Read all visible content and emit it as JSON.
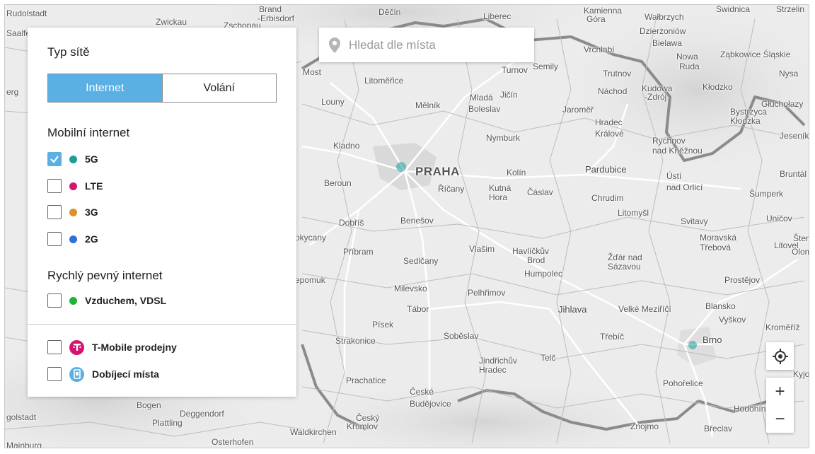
{
  "search": {
    "placeholder": "Hledat dle místa",
    "icon": "map-pin-icon"
  },
  "panel": {
    "title": "Typ sítě",
    "toggle": {
      "active": "Internet",
      "inactive": "Volání"
    },
    "mobile_section": "Mobilní internet",
    "mobile_options": [
      {
        "label": "5G",
        "color": "#1a9e96",
        "checked": true
      },
      {
        "label": "LTE",
        "color": "#d6136e",
        "checked": false
      },
      {
        "label": "3G",
        "color": "#d9912a",
        "checked": false
      },
      {
        "label": "2G",
        "color": "#2f6fdc",
        "checked": false
      }
    ],
    "fixed_section": "Rychlý pevný internet",
    "fixed_options": [
      {
        "label": "Vzduchem, VDSL",
        "color": "#1fb23a",
        "checked": false
      }
    ],
    "extra_options": [
      {
        "label": "T-Mobile prodejny",
        "color": "#d6136e",
        "icon": "t-mobile-logo-icon",
        "checked": false
      },
      {
        "label": "Dobíjecí místa",
        "color": "#5aafe3",
        "icon": "phone-card-icon",
        "checked": false
      }
    ]
  },
  "controls": {
    "locate_icon": "crosshair-icon",
    "zoom_in": "+",
    "zoom_out": "−"
  },
  "map": {
    "labels": [
      {
        "t": "Rudolstadt"
      },
      {
        "t": "Saalfeld"
      },
      {
        "t": "erg"
      },
      {
        "t": "Zwickau"
      },
      {
        "t": "Brand"
      },
      {
        "t": "-Erbisdorf"
      },
      {
        "t": "Zschopau"
      },
      {
        "t": "Děčín"
      },
      {
        "t": "Liberec"
      },
      {
        "t": "Kamienna"
      },
      {
        "t": "Góra"
      },
      {
        "t": "Wałbrzych"
      },
      {
        "t": "Świdnica"
      },
      {
        "t": "Strzelin"
      },
      {
        "t": "Dzierżoniów"
      },
      {
        "t": "Bielawa"
      },
      {
        "t": "Nowa"
      },
      {
        "t": "Ruda"
      },
      {
        "t": "Ząbkowice Śląskie"
      },
      {
        "t": "Nysa"
      },
      {
        "t": "Vrchlabí"
      },
      {
        "t": "Semily"
      },
      {
        "t": "Trutnov"
      },
      {
        "t": "Turnov"
      },
      {
        "t": "Most"
      },
      {
        "t": "Litoměřice"
      },
      {
        "t": "Mladá"
      },
      {
        "t": "Boleslav"
      },
      {
        "t": "Jičín"
      },
      {
        "t": "Náchod"
      },
      {
        "t": "Kudowa"
      },
      {
        "t": "-Zdrój"
      },
      {
        "t": "Kłodzko"
      },
      {
        "t": "Bystrzyca"
      },
      {
        "t": "Kłodzka"
      },
      {
        "t": "Głuchołazy"
      },
      {
        "t": "Louny"
      },
      {
        "t": "Mělník"
      },
      {
        "t": "Jaroměř"
      },
      {
        "t": "Hradec"
      },
      {
        "t": "Králové"
      },
      {
        "t": "Rychnov"
      },
      {
        "t": "nad Kněžnou"
      },
      {
        "t": "Jeseník"
      },
      {
        "t": "Kladno"
      },
      {
        "t": "Nymburk"
      },
      {
        "t": "PRAHA"
      },
      {
        "t": "Kolín"
      },
      {
        "t": "Pardubice"
      },
      {
        "t": "Bruntál"
      },
      {
        "t": "Ústí"
      },
      {
        "t": "nad Orlicí"
      },
      {
        "t": "Beroun"
      },
      {
        "t": "Říčany"
      },
      {
        "t": "Kutná"
      },
      {
        "t": "Hora"
      },
      {
        "t": "Čáslav"
      },
      {
        "t": "Chrudim"
      },
      {
        "t": "Šumperk"
      },
      {
        "t": "Litomyšl"
      },
      {
        "t": "Dobříš"
      },
      {
        "t": "Benešov"
      },
      {
        "t": "Svitavy"
      },
      {
        "t": "Uničov"
      },
      {
        "t": "okycany"
      },
      {
        "t": "Moravská"
      },
      {
        "t": "Třebová"
      },
      {
        "t": "Šten"
      },
      {
        "t": "Příbram"
      },
      {
        "t": "Vlašim"
      },
      {
        "t": "Havlíčkův"
      },
      {
        "t": "Brod"
      },
      {
        "t": "Litovel"
      },
      {
        "t": "Olom"
      },
      {
        "t": "Sedlčany"
      },
      {
        "t": "Žďár nad"
      },
      {
        "t": "Sázavou"
      },
      {
        "t": "Humpolec"
      },
      {
        "t": "epomuk"
      },
      {
        "t": "Prostějov"
      },
      {
        "t": "Milevsko"
      },
      {
        "t": "Pelhřimov"
      },
      {
        "t": "Jihlava"
      },
      {
        "t": "Velké Meziříčí"
      },
      {
        "t": "Blansko"
      },
      {
        "t": "Tábor"
      },
      {
        "t": "Vyškov"
      },
      {
        "t": "Písek"
      },
      {
        "t": "Kroměříž"
      },
      {
        "t": "Soběslav"
      },
      {
        "t": "Třebíč"
      },
      {
        "t": "Strakonice"
      },
      {
        "t": "Brno"
      },
      {
        "t": "Jindřichův"
      },
      {
        "t": "Hradec"
      },
      {
        "t": "Telč"
      },
      {
        "t": "Prachatice"
      },
      {
        "t": "České"
      },
      {
        "t": "Budějovice"
      },
      {
        "t": "Pohořelice"
      },
      {
        "t": "Hodonín"
      },
      {
        "t": "Bogen"
      },
      {
        "t": "Deggendorf"
      },
      {
        "t": "Český"
      },
      {
        "t": "Krumlov"
      },
      {
        "t": "golstadt"
      },
      {
        "t": "Plattling"
      },
      {
        "t": "Znojmo"
      },
      {
        "t": "Břeclav"
      },
      {
        "t": "Waldkirchen"
      },
      {
        "t": "Mainburg"
      },
      {
        "t": "Osterhofen"
      },
      {
        "t": "Kyjov"
      }
    ]
  }
}
